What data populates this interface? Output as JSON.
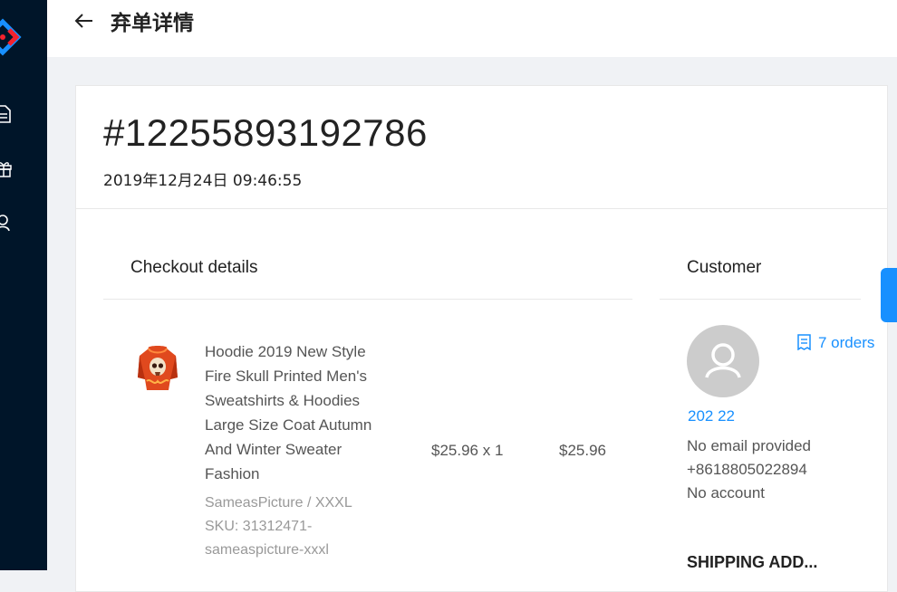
{
  "header": {
    "title": "弃单详情"
  },
  "order": {
    "number": "#12255893192786",
    "date": "2019年12月24日 09:46:55"
  },
  "checkout": {
    "title": "Checkout details",
    "item": {
      "name": "Hoodie 2019 New Style Fire Skull Printed Men's Sweatshirts & Hoodies Large Size Coat Autumn And Winter Sweater Fashion",
      "variant": "SameasPicture / XXXL",
      "sku": "SKU: 31312471-sameaspicture-xxxl",
      "unit_price": "$25.96 x 1",
      "total": "$25.96"
    }
  },
  "customer": {
    "title": "Customer",
    "orders_label": "7 orders",
    "name": "202 22",
    "email": "No email provided",
    "phone": "+8618805022894",
    "account": "No account"
  },
  "shipping": {
    "title": "SHIPPING ADD..."
  },
  "colors": {
    "sidebar": "#001529",
    "accent": "#1890ff"
  }
}
